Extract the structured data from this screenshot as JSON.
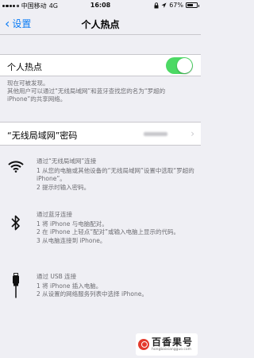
{
  "status_bar": {
    "carrier": "中国移动",
    "network": "4G",
    "time": "16:08",
    "battery": "67%",
    "battery_level": 0.67,
    "signal_bars_filled": 4
  },
  "nav": {
    "back_label": "设置",
    "title": "个人热点"
  },
  "hotspot": {
    "label": "个人热点",
    "enabled": true,
    "status_note": "现在可被发现。",
    "share_note": "其他用户可以通过“无线局域网”和蓝牙查找您的名为“罗超的 iPhone”的共享网络。"
  },
  "wifi_password": {
    "label": "“无线局域网”密码"
  },
  "instructions": {
    "wifi": {
      "icon": "wifi-icon",
      "title": "通过“无线局域网”连接",
      "steps": [
        "1 从您的电脑或其他设备的“无线局域网”设置中选取“罗超的 iPhone”。",
        "2 提示时输入密码。"
      ]
    },
    "bluetooth": {
      "icon": "bluetooth-icon",
      "title": "通过蓝牙连接",
      "steps": [
        "1 将 iPhone 与电脑配对。",
        "2 在 iPhone 上轻点“配对”或输入电脑上显示的代码。",
        "3 从电脑连接到 iPhone。"
      ]
    },
    "usb": {
      "icon": "usb-icon",
      "title": "通过 USB 连接",
      "steps": [
        "1 将 iPhone 插入电脑。",
        "2 从设置的网络服务列表中选择 iPhone。"
      ]
    }
  },
  "watermark": {
    "name": "百香果号",
    "url": "hongbaixiangguo.com"
  },
  "colors": {
    "accent": "#0a7bf5",
    "toggle_on": "#4cd964",
    "background": "#efeff4"
  }
}
